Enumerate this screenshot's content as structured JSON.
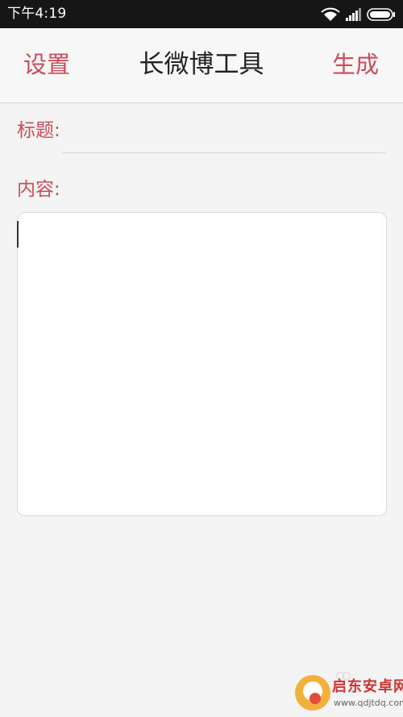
{
  "status_bar": {
    "time": "下午4:19",
    "icons": [
      "wifi-icon",
      "signal-icon",
      "battery-icon"
    ]
  },
  "header": {
    "left_label": "设置",
    "title": "长微博工具",
    "right_label": "生成"
  },
  "form": {
    "title_label": "标题:",
    "title_value": "",
    "content_label": "内容:",
    "content_value": ""
  },
  "watermark": {
    "name": "启东安卓网",
    "url": "www.qdjtdq.com"
  },
  "colors": {
    "accent": "#cb4c5a",
    "status_bar": "#161616",
    "background": "#f4f4f4",
    "title_text": "#222222"
  }
}
